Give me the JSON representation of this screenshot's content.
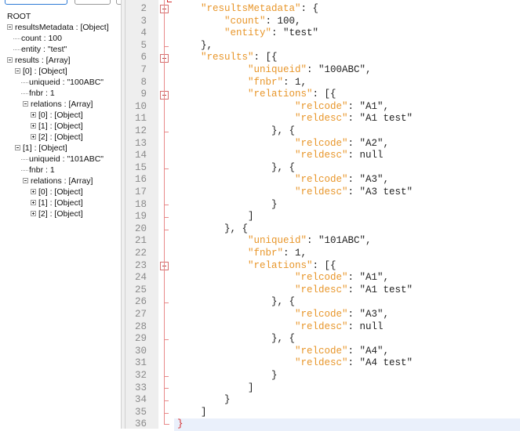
{
  "tree": {
    "nodes": [
      {
        "text": "ROOT",
        "depth": 0,
        "expander": "none"
      },
      {
        "text": "resultsMetadata : [Object]",
        "depth": 1,
        "expander": "expanded"
      },
      {
        "text": "count : 100",
        "depth": 2,
        "expander": "none"
      },
      {
        "text": "entity : \"test\"",
        "depth": 2,
        "expander": "none"
      },
      {
        "text": "results : [Array]",
        "depth": 1,
        "expander": "expanded"
      },
      {
        "text": "[0] : [Object]",
        "depth": 2,
        "expander": "expanded"
      },
      {
        "text": "uniqueid : \"100ABC\"",
        "depth": 3,
        "expander": "none"
      },
      {
        "text": "fnbr : 1",
        "depth": 3,
        "expander": "none"
      },
      {
        "text": "relations : [Array]",
        "depth": 3,
        "expander": "expanded"
      },
      {
        "text": "[0] : [Object]",
        "depth": 4,
        "expander": "collapsed"
      },
      {
        "text": "[1] : [Object]",
        "depth": 4,
        "expander": "collapsed"
      },
      {
        "text": "[2] : [Object]",
        "depth": 4,
        "expander": "collapsed"
      },
      {
        "text": "[1] : [Object]",
        "depth": 2,
        "expander": "expanded"
      },
      {
        "text": "uniqueid : \"101ABC\"",
        "depth": 3,
        "expander": "none"
      },
      {
        "text": "fnbr : 1",
        "depth": 3,
        "expander": "none"
      },
      {
        "text": "relations : [Array]",
        "depth": 3,
        "expander": "expanded"
      },
      {
        "text": "[0] : [Object]",
        "depth": 4,
        "expander": "collapsed"
      },
      {
        "text": "[1] : [Object]",
        "depth": 4,
        "expander": "collapsed"
      },
      {
        "text": "[2] : [Object]",
        "depth": 4,
        "expander": "collapsed"
      }
    ]
  },
  "editor": {
    "current_line": 36,
    "lines": [
      {
        "num": "2",
        "indent": "    ",
        "key": "\"resultsMetadata\"",
        "rest": ": {",
        "fold": "start"
      },
      {
        "num": "3",
        "indent": "        ",
        "key": "\"count\"",
        "rest": ": 100,",
        "fold": "line"
      },
      {
        "num": "4",
        "indent": "        ",
        "key": "\"entity\"",
        "rest": ": \"test\"",
        "fold": "line"
      },
      {
        "num": "5",
        "indent": "    ",
        "key": "",
        "rest": "},",
        "fold": "end"
      },
      {
        "num": "6",
        "indent": "    ",
        "key": "\"results\"",
        "rest": ": [{",
        "fold": "start"
      },
      {
        "num": "7",
        "indent": "            ",
        "key": "\"uniqueid\"",
        "rest": ": \"100ABC\",",
        "fold": "line"
      },
      {
        "num": "8",
        "indent": "            ",
        "key": "\"fnbr\"",
        "rest": ": 1,",
        "fold": "line"
      },
      {
        "num": "9",
        "indent": "            ",
        "key": "\"relations\"",
        "rest": ": [{",
        "fold": "start"
      },
      {
        "num": "10",
        "indent": "                    ",
        "key": "\"relcode\"",
        "rest": ": \"A1\",",
        "fold": "line"
      },
      {
        "num": "11",
        "indent": "                    ",
        "key": "\"reldesc\"",
        "rest": ": \"A1 test\"",
        "fold": "line"
      },
      {
        "num": "12",
        "indent": "                ",
        "key": "",
        "rest": "}, {",
        "fold": "mid"
      },
      {
        "num": "13",
        "indent": "                    ",
        "key": "\"relcode\"",
        "rest": ": \"A2\",",
        "fold": "line"
      },
      {
        "num": "14",
        "indent": "                    ",
        "key": "\"reldesc\"",
        "rest": ": null",
        "fold": "line"
      },
      {
        "num": "15",
        "indent": "                ",
        "key": "",
        "rest": "}, {",
        "fold": "mid"
      },
      {
        "num": "16",
        "indent": "                    ",
        "key": "\"relcode\"",
        "rest": ": \"A3\",",
        "fold": "line"
      },
      {
        "num": "17",
        "indent": "                    ",
        "key": "\"reldesc\"",
        "rest": ": \"A3 test\"",
        "fold": "line"
      },
      {
        "num": "18",
        "indent": "                ",
        "key": "",
        "rest": "}",
        "fold": "mid"
      },
      {
        "num": "19",
        "indent": "            ",
        "key": "",
        "rest": "]",
        "fold": "end"
      },
      {
        "num": "20",
        "indent": "        ",
        "key": "",
        "rest": "}, {",
        "fold": "mid"
      },
      {
        "num": "21",
        "indent": "            ",
        "key": "\"uniqueid\"",
        "rest": ": \"101ABC\",",
        "fold": "line"
      },
      {
        "num": "22",
        "indent": "            ",
        "key": "\"fnbr\"",
        "rest": ": 1,",
        "fold": "line"
      },
      {
        "num": "23",
        "indent": "            ",
        "key": "\"relations\"",
        "rest": ": [{",
        "fold": "start"
      },
      {
        "num": "24",
        "indent": "                    ",
        "key": "\"relcode\"",
        "rest": ": \"A1\",",
        "fold": "line"
      },
      {
        "num": "25",
        "indent": "                    ",
        "key": "\"reldesc\"",
        "rest": ": \"A1 test\"",
        "fold": "line"
      },
      {
        "num": "26",
        "indent": "                ",
        "key": "",
        "rest": "}, {",
        "fold": "mid"
      },
      {
        "num": "27",
        "indent": "                    ",
        "key": "\"relcode\"",
        "rest": ": \"A3\",",
        "fold": "line"
      },
      {
        "num": "28",
        "indent": "                    ",
        "key": "\"reldesc\"",
        "rest": ": null",
        "fold": "line"
      },
      {
        "num": "29",
        "indent": "                ",
        "key": "",
        "rest": "}, {",
        "fold": "mid"
      },
      {
        "num": "30",
        "indent": "                    ",
        "key": "\"relcode\"",
        "rest": ": \"A4\",",
        "fold": "line"
      },
      {
        "num": "31",
        "indent": "                    ",
        "key": "\"reldesc\"",
        "rest": ": \"A4 test\"",
        "fold": "line"
      },
      {
        "num": "32",
        "indent": "                ",
        "key": "",
        "rest": "}",
        "fold": "mid"
      },
      {
        "num": "33",
        "indent": "            ",
        "key": "",
        "rest": "]",
        "fold": "end"
      },
      {
        "num": "34",
        "indent": "        ",
        "key": "",
        "rest": "}",
        "fold": "mid"
      },
      {
        "num": "35",
        "indent": "    ",
        "key": "",
        "rest": "]",
        "fold": "end"
      },
      {
        "num": "36",
        "indent": "",
        "key": "",
        "rest": "}",
        "fold": "root-end"
      }
    ]
  },
  "colors": {
    "key": "#e8962a",
    "fold": "#e88a8a",
    "gutter_bg": "#eeeeee",
    "current_line_bg": "#eaf0fb"
  }
}
